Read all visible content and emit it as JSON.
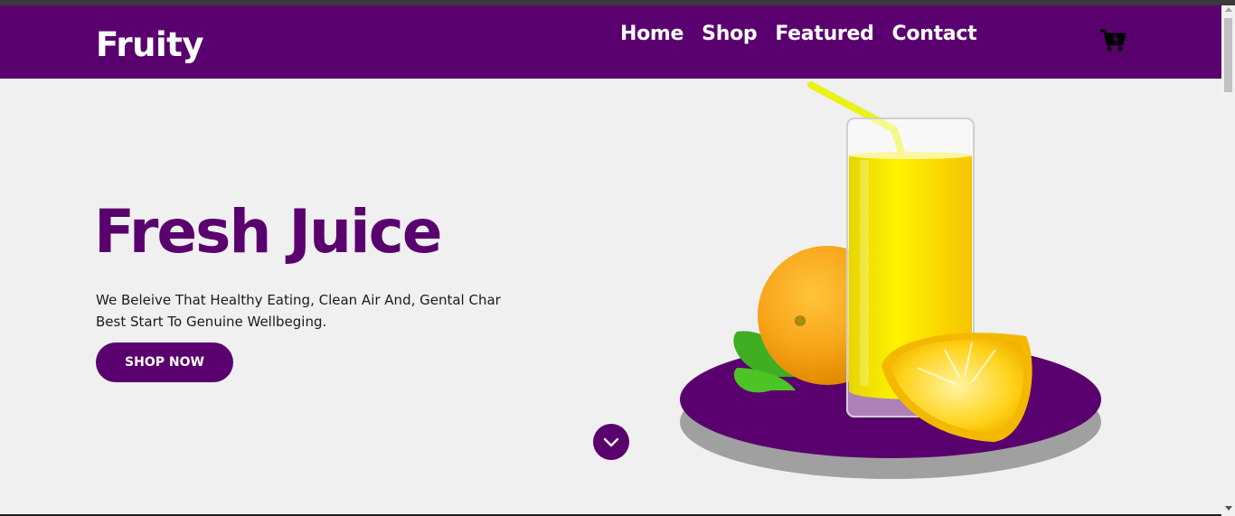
{
  "brand": {
    "name": "Fruity"
  },
  "nav": {
    "home": "Home",
    "shop": "Shop",
    "featured": "Featured",
    "contact": "Contact"
  },
  "cart": {
    "icon": "cart-icon"
  },
  "hero": {
    "title": "Fresh Juice",
    "description": "We Beleive That Healthy Eating, Clean Air And, Gental Char Best Start To Genuine Wellbeging.",
    "cta_label": "SHOP NOW",
    "scroll_icon": "chevron-down-icon",
    "image_icon": "juice-glass-oranges-image"
  },
  "colors": {
    "primary": "#5a006e",
    "background": "#f0f0f0",
    "text": "#1a1a1a",
    "juice": "#f5d400"
  }
}
